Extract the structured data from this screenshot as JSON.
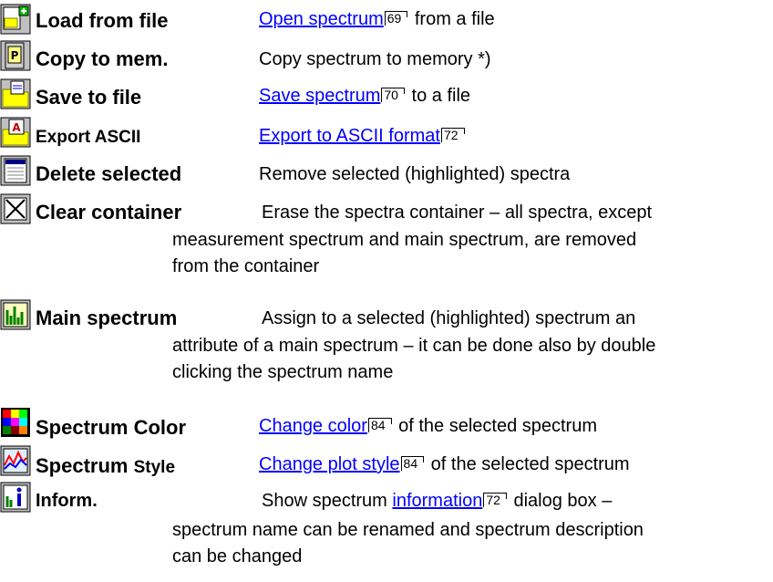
{
  "items": [
    {
      "icon": "load-file-icon",
      "term": "Load from file",
      "link": "Open spectrum",
      "ref": "69",
      "after": " from a file"
    },
    {
      "icon": "copy-memory-icon",
      "term": "Copy to mem.",
      "text": "Copy spectrum to memory *)"
    },
    {
      "icon": "save-file-icon",
      "term": "Save to file",
      "link": "Save spectrum",
      "ref": "70",
      "after": " to a file"
    },
    {
      "icon": "export-ascii-icon",
      "term": "Export ASCII",
      "link": "Export to ASCII format",
      "ref": "72"
    },
    {
      "icon": "delete-selected-icon",
      "term": "Delete selected",
      "text": "Remove selected (highlighted) spectra"
    },
    {
      "icon": "clear-container-icon",
      "term": "Clear container",
      "text": "Erase the spectra container – all spectra, except",
      "cont": [
        "measurement spectrum and main spectrum, are removed",
        "from the container"
      ]
    },
    {
      "icon": "main-spectrum-icon",
      "term": "Main spectrum",
      "text": "Assign to a selected (highlighted) spectrum an",
      "cont": [
        "attribute of a main spectrum – it can be done also by double",
        "clicking the spectrum name"
      ]
    },
    {
      "icon": "spectrum-color-icon",
      "term": "Spectrum Color",
      "link": "Change color",
      "ref": "84",
      "after": " of the selected spectrum"
    },
    {
      "icon": "spectrum-style-icon",
      "term_a": "Spectrum ",
      "term_b": "Style",
      "link": "Change plot style",
      "ref": "84",
      "after": " of the selected spectrum"
    },
    {
      "icon": "information-icon",
      "term": "Inform.",
      "pre": "Show spectrum ",
      "link": "information",
      "ref": "72",
      "after": " dialog box –",
      "cont": [
        "spectrum name can be renamed and spectrum description",
        "can be changed"
      ]
    }
  ],
  "colors": {
    "link": "#0000ff"
  }
}
